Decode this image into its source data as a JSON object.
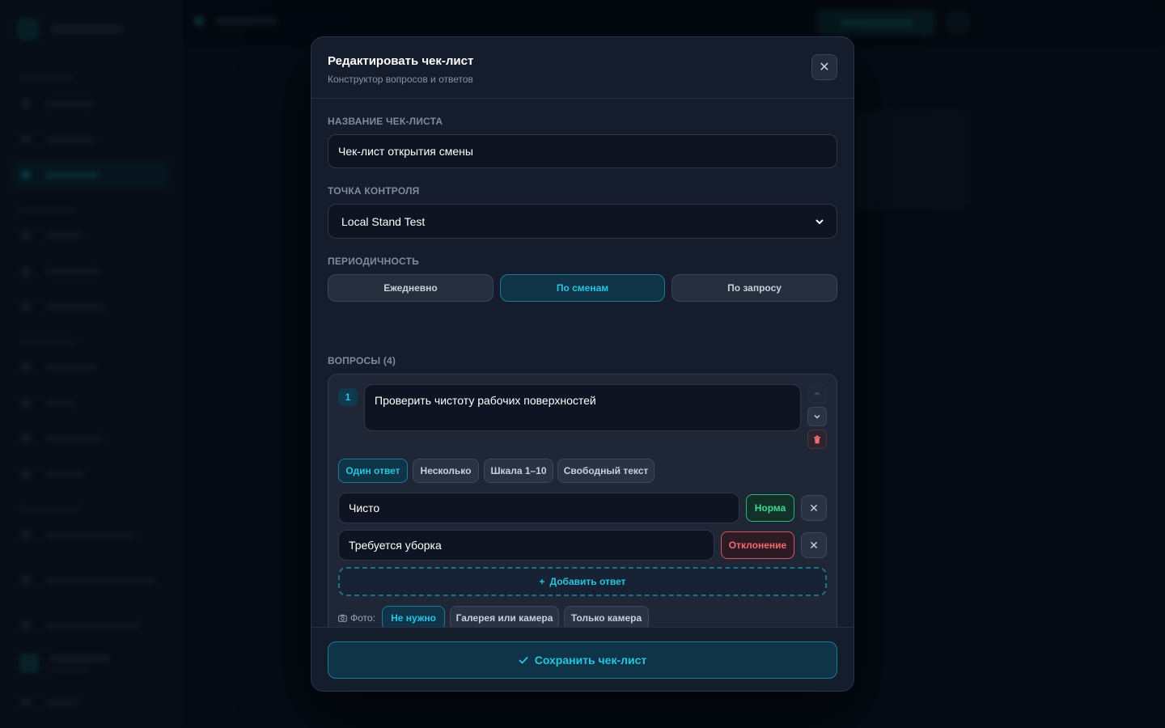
{
  "modal": {
    "title": "Редактировать чек-лист",
    "subtitle": "Конструктор вопросов и ответов",
    "close_label": "✕",
    "name_label": "Название чек-листа",
    "name_value": "Чек-лист открытия смены",
    "point_label": "Точка контроля",
    "point_value": "Local Stand Test",
    "period_label": "Периодичность",
    "period_options": [
      "Ежедневно",
      "По сменам",
      "По запросу"
    ],
    "period_selected": "По сменам",
    "questions_label": "Вопросы (4)",
    "questions": [
      {
        "number": "1",
        "text": "Проверить чистоту рабочих поверхностей",
        "types": [
          "Один ответ",
          "Несколько",
          "Шкала 1–10",
          "Свободный текст"
        ],
        "type_selected": "Один ответ",
        "answers": [
          {
            "text": "Чисто",
            "status": "Норма"
          },
          {
            "text": "Требуется уборка",
            "status": "Отклонение"
          }
        ],
        "add_answer_label": "Добавить ответ",
        "photo_label": "Фото:",
        "photo_options": [
          "Не нужно",
          "Галерея или камера",
          "Только камера"
        ],
        "photo_selected": "Не нужно"
      }
    ],
    "save_label": "Сохранить чек-лист"
  },
  "colors": {
    "accent": "#27c6e0",
    "ok": "#3ddc8a",
    "deviation": "#f06b72",
    "modal_bg": "#151c2c"
  }
}
